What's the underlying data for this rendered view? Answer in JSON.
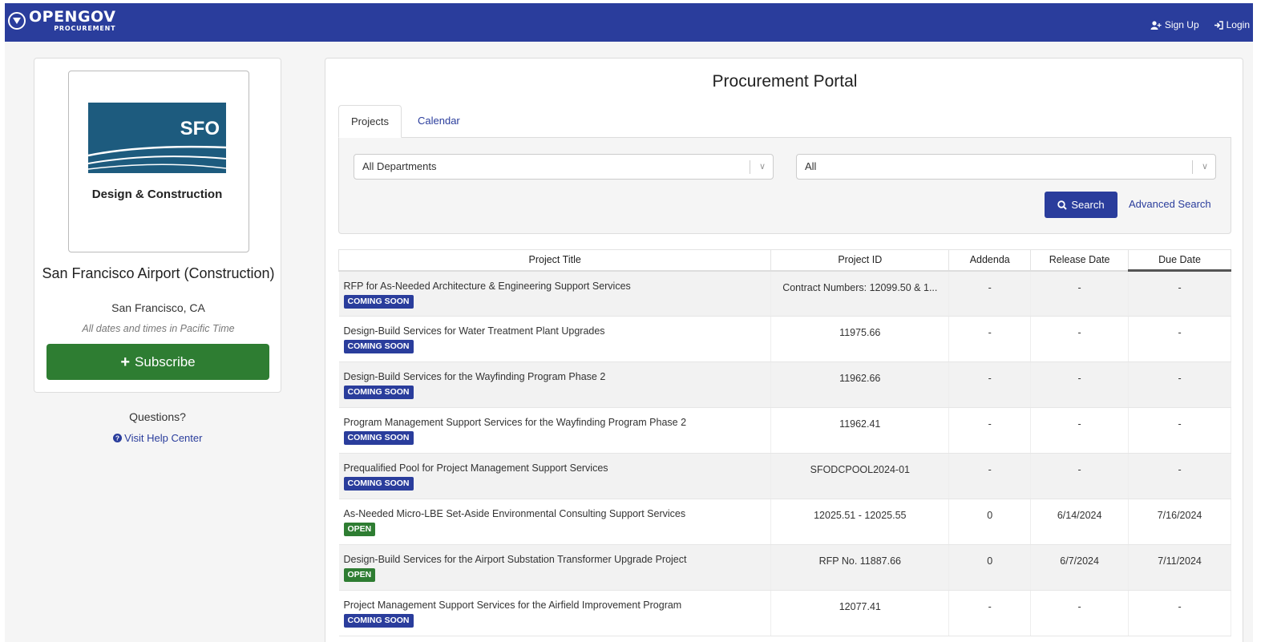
{
  "header": {
    "logo_main": "OPENGOV",
    "logo_sub": "PROCUREMENT",
    "sign_up": "Sign Up",
    "login": "Login"
  },
  "sidebar": {
    "logo_text": "SFO",
    "logo_caption": "Design & Construction",
    "org_name": "San Francisco Airport (Construction)",
    "location": "San Francisco, CA",
    "timezone_note": "All dates and times in Pacific Time",
    "subscribe_label": "Subscribe",
    "questions": "Questions?",
    "help_link": "Visit Help Center"
  },
  "portal": {
    "title": "Procurement Portal",
    "tabs": [
      {
        "label": "Projects",
        "active": true
      },
      {
        "label": "Calendar",
        "active": false
      }
    ],
    "filters": {
      "department": "All Departments",
      "status": "All"
    },
    "search_label": "Search",
    "advanced_search": "Advanced Search"
  },
  "table": {
    "columns": [
      "Project Title",
      "Project ID",
      "Addenda",
      "Release Date",
      "Due Date"
    ],
    "rows": [
      {
        "title": "RFP for As-Needed Architecture & Engineering Support Services",
        "status": "COMING SOON",
        "project_id": "Contract Numbers: 12099.50 & 1...",
        "addenda": "-",
        "release": "-",
        "due": "-"
      },
      {
        "title": "Design-Build Services for Water Treatment Plant Upgrades",
        "status": "COMING SOON",
        "project_id": "11975.66",
        "addenda": "-",
        "release": "-",
        "due": "-"
      },
      {
        "title": "Design-Build Services for the Wayfinding Program Phase 2",
        "status": "COMING SOON",
        "project_id": "11962.66",
        "addenda": "-",
        "release": "-",
        "due": "-"
      },
      {
        "title": "Program Management Support Services for the Wayfinding Program Phase 2",
        "status": "COMING SOON",
        "project_id": "11962.41",
        "addenda": "-",
        "release": "-",
        "due": "-"
      },
      {
        "title": "Prequalified Pool for Project Management Support Services",
        "status": "COMING SOON",
        "project_id": "SFODCPOOL2024-01",
        "addenda": "-",
        "release": "-",
        "due": "-"
      },
      {
        "title": "As-Needed Micro-LBE Set-Aside Environmental Consulting Support Services",
        "status": "OPEN",
        "project_id": "12025.51 - 12025.55",
        "addenda": "0",
        "release": "6/14/2024",
        "due": "7/16/2024"
      },
      {
        "title": "Design-Build Services for the Airport Substation Transformer Upgrade Project",
        "status": "OPEN",
        "project_id": "RFP No. 11887.66",
        "addenda": "0",
        "release": "6/7/2024",
        "due": "7/11/2024"
      },
      {
        "title": "Project Management Support Services for the Airfield Improvement Program",
        "status": "COMING SOON",
        "project_id": "12077.41",
        "addenda": "-",
        "release": "-",
        "due": "-"
      }
    ]
  },
  "colors": {
    "brand": "#2a3d9c",
    "open": "#2e7d32",
    "sfo_teal": "#1d5b7e"
  }
}
